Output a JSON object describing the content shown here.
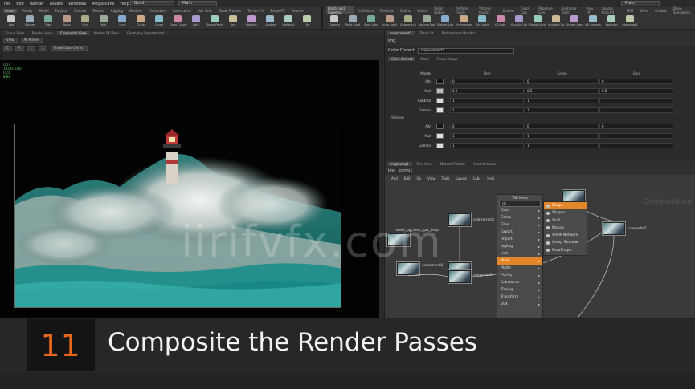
{
  "menubar": {
    "items": [
      "File",
      "Edit",
      "Render",
      "Assets",
      "Windows",
      "Megascans",
      "Help"
    ],
    "desktop": "Build",
    "main_left": "Main",
    "main_right": "Main"
  },
  "shelf_left": {
    "tabs": [
      "Create",
      "Modify",
      "Model",
      "Polygon",
      "Deform",
      "Texture",
      "Rigging",
      "Muscles",
      "Characters",
      "Constraints",
      "Hair Utils",
      "Guide Process",
      "Terrain FX",
      "SimpleFX",
      "Volume"
    ],
    "tools": [
      "Box",
      "Sphere",
      "Tube",
      "Torus",
      "Grid",
      "Null",
      "Line",
      "Circle",
      "Curve",
      "Draw Curve",
      "Path",
      "Spray Paint",
      "Text",
      "Platonic",
      "L-System",
      "Metaball",
      "File"
    ]
  },
  "shelf_right": {
    "tabs": [
      "Lights and Cameras",
      "Collisions",
      "Particles",
      "Grains",
      "Vellum",
      "Rigid Bodies",
      "Particle Fluids",
      "Viscous Fluids",
      "Oceans",
      "Fluid Con",
      "Populate Con",
      "Container Tools",
      "Pyro FX",
      "Sparse Pyro FX",
      "FEM",
      "Wires",
      "Crowds",
      "Drive Simulation"
    ],
    "tools": [
      "Camera",
      "Point Light",
      "Spot Light",
      "Area Light",
      "Geometry Light",
      "Volume Light",
      "Distant Light",
      "Environment Light",
      "Sky Light",
      "GI Light",
      "Caustic Light",
      "Portal Light",
      "Ambient Light",
      "Stereo Camera",
      "VR Camera",
      "Switcher",
      "Gamepad Camera"
    ]
  },
  "left_pane_tabs": [
    "Scene View",
    "Render View",
    "Composite View",
    "Motion FX View",
    "Geometry Spreadsheet"
  ],
  "right_pane_tabs": [
    "colorcorrect1",
    "Take List",
    "Performance Monitor"
  ],
  "viewport": {
    "toolbar_row1": [
      "View",
      "All Planes"
    ],
    "toolbar_row2": [
      "C",
      "A",
      "1",
      "2",
      "Show Color Correct"
    ],
    "info": [
      "OUT",
      "1920x1080",
      "(0,0)",
      "8-Bit"
    ]
  },
  "params": {
    "path": "img",
    "node_type": "Color Correct",
    "node_name": "colorcorrect1",
    "tabs": [
      "Color Correct",
      "Mask",
      "Frame Scope"
    ],
    "headers": [
      "Master",
      "Red",
      "Green",
      "Blue"
    ],
    "master_rows": [
      {
        "label": "Add",
        "values": [
          "0",
          "0",
          "0"
        ]
      },
      {
        "label": "Mult",
        "values": [
          "0.5",
          "0.5",
          "0.5"
        ]
      },
      {
        "label": "Contrast",
        "values": [
          "1",
          "1",
          "1"
        ]
      },
      {
        "label": "Gamma",
        "values": [
          "1",
          "1",
          "1"
        ]
      }
    ],
    "section2": "Shadow",
    "shadow_rows": [
      {
        "label": "Add",
        "values": [
          "0",
          "0",
          "0"
        ]
      },
      {
        "label": "Mult",
        "values": [
          "1",
          "1",
          "1"
        ]
      },
      {
        "label": "Gamma",
        "values": [
          "1",
          "1",
          "1"
        ]
      }
    ]
  },
  "network": {
    "tabs": [
      "img/comp1",
      "Tree View",
      "Material Palette",
      "Asset Browser"
    ],
    "path": "img",
    "node": "comp1",
    "menu": [
      "Add",
      "Edit",
      "Go",
      "View",
      "Tools",
      "Layout",
      "Labs",
      "Help"
    ],
    "watermark": "Compositing",
    "nodes": [
      "colorcorrect1",
      "colorcorrect2",
      "composite1",
      "composite2",
      "render_bg_deep_spot_deep",
      "render_bg_01_alpha"
    ]
  },
  "tab_menu": {
    "title": "TAB Menu",
    "search": "ch",
    "items": [
      "Color",
      "Comp",
      "Filter",
      "Export",
      "Import",
      "Keying",
      "Link",
      "Mask",
      "Matte",
      "Pix/Op",
      "Substance",
      "Timing",
      "Transform",
      "VEX"
    ],
    "highlight_index": 7,
    "submenu": [
      "Shape",
      "Shapes",
      "Shift",
      "Mosaic",
      "SHOP Network",
      "Comp Shadow",
      "RotoShape"
    ]
  },
  "title_card": {
    "number": "11",
    "title": "Composite the Render Passes"
  },
  "watermark": "iirifvfx.com",
  "colors": {
    "accent": "#e8661c",
    "menu_highlight": "#e3862a"
  }
}
